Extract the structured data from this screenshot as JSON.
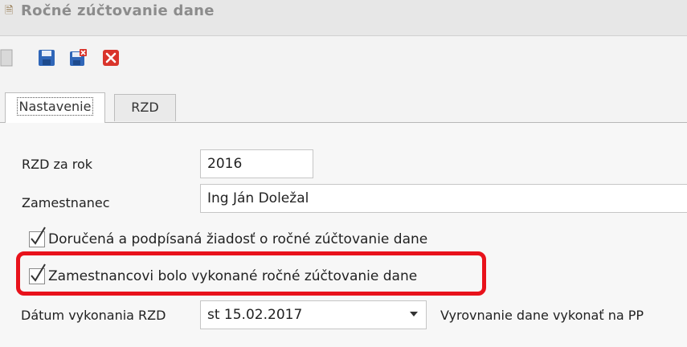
{
  "window": {
    "title": "Ročné zúčtovanie dane",
    "icon": "form-icon"
  },
  "toolbar": {
    "buttons": [
      {
        "name": "new-icon"
      },
      {
        "name": "save-icon"
      },
      {
        "name": "save-close-icon"
      },
      {
        "name": "close-icon"
      }
    ]
  },
  "tabs": [
    {
      "label": "Nastavenie",
      "active": true
    },
    {
      "label": "RZD",
      "active": false
    }
  ],
  "form": {
    "year_label": "RZD za rok",
    "year_value": "2016",
    "employee_label": "Zamestnanec",
    "employee_value": "Ing Ján Doležal",
    "checkbox_request": "Doručená a podpísaná žiadosť o ročné zúčtovanie dane",
    "checkbox_done": "Zamestnancovi bolo vykonané ročné zúčtovanie dane",
    "date_label": "Dátum vykonania RZD",
    "date_value": "st 15.02.2017",
    "settle_label": "Vyrovnanie dane vykonať na PP"
  },
  "colors": {
    "highlight": "#e8121b"
  }
}
